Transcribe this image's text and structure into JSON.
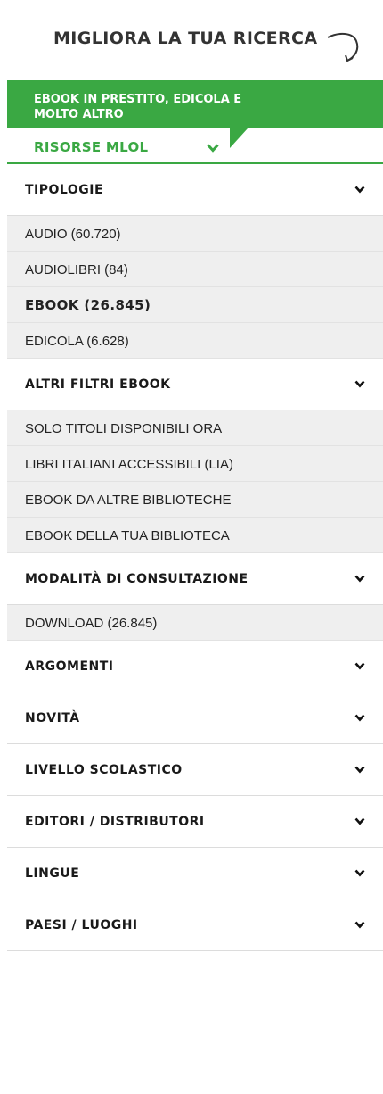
{
  "header": {
    "title": "MIGLIORA LA TUA RICERCA"
  },
  "banner": {
    "line1": "EBOOK IN PRESTITO, EDICOLA E",
    "line2": "MOLTO ALTRO"
  },
  "mlol": {
    "label": "RISORSE MLOL"
  },
  "colors": {
    "accent": "#3aa843",
    "item_bg": "#efefef"
  },
  "filters": {
    "tipologie": {
      "label": "TIPOLOGIE",
      "items": [
        {
          "label": "AUDIO (60.720)"
        },
        {
          "label": "AUDIOLIBRI (84)"
        },
        {
          "label": "EBOOK (26.845)",
          "active": true
        },
        {
          "label": "EDICOLA (6.628)"
        }
      ]
    },
    "altri_filtri": {
      "label": "ALTRI FILTRI EBOOK",
      "items": [
        {
          "label": "SOLO TITOLI DISPONIBILI ORA"
        },
        {
          "label": "LIBRI ITALIANI ACCESSIBILI (LIA)"
        },
        {
          "label": "EBOOK DA ALTRE BIBLIOTECHE"
        },
        {
          "label": "EBOOK DELLA TUA BIBLIOTECA"
        }
      ]
    },
    "modalita": {
      "label": "MODALITÀ DI CONSULTAZIONE",
      "items": [
        {
          "label": "DOWNLOAD (26.845)"
        }
      ]
    },
    "argomenti": {
      "label": "ARGOMENTI"
    },
    "novita": {
      "label": "NOVITÀ"
    },
    "livello": {
      "label": "LIVELLO SCOLASTICO"
    },
    "editori": {
      "label": "EDITORI / DISTRIBUTORI"
    },
    "lingue": {
      "label": "LINGUE"
    },
    "paesi": {
      "label": "PAESI / LUOGHI"
    }
  }
}
